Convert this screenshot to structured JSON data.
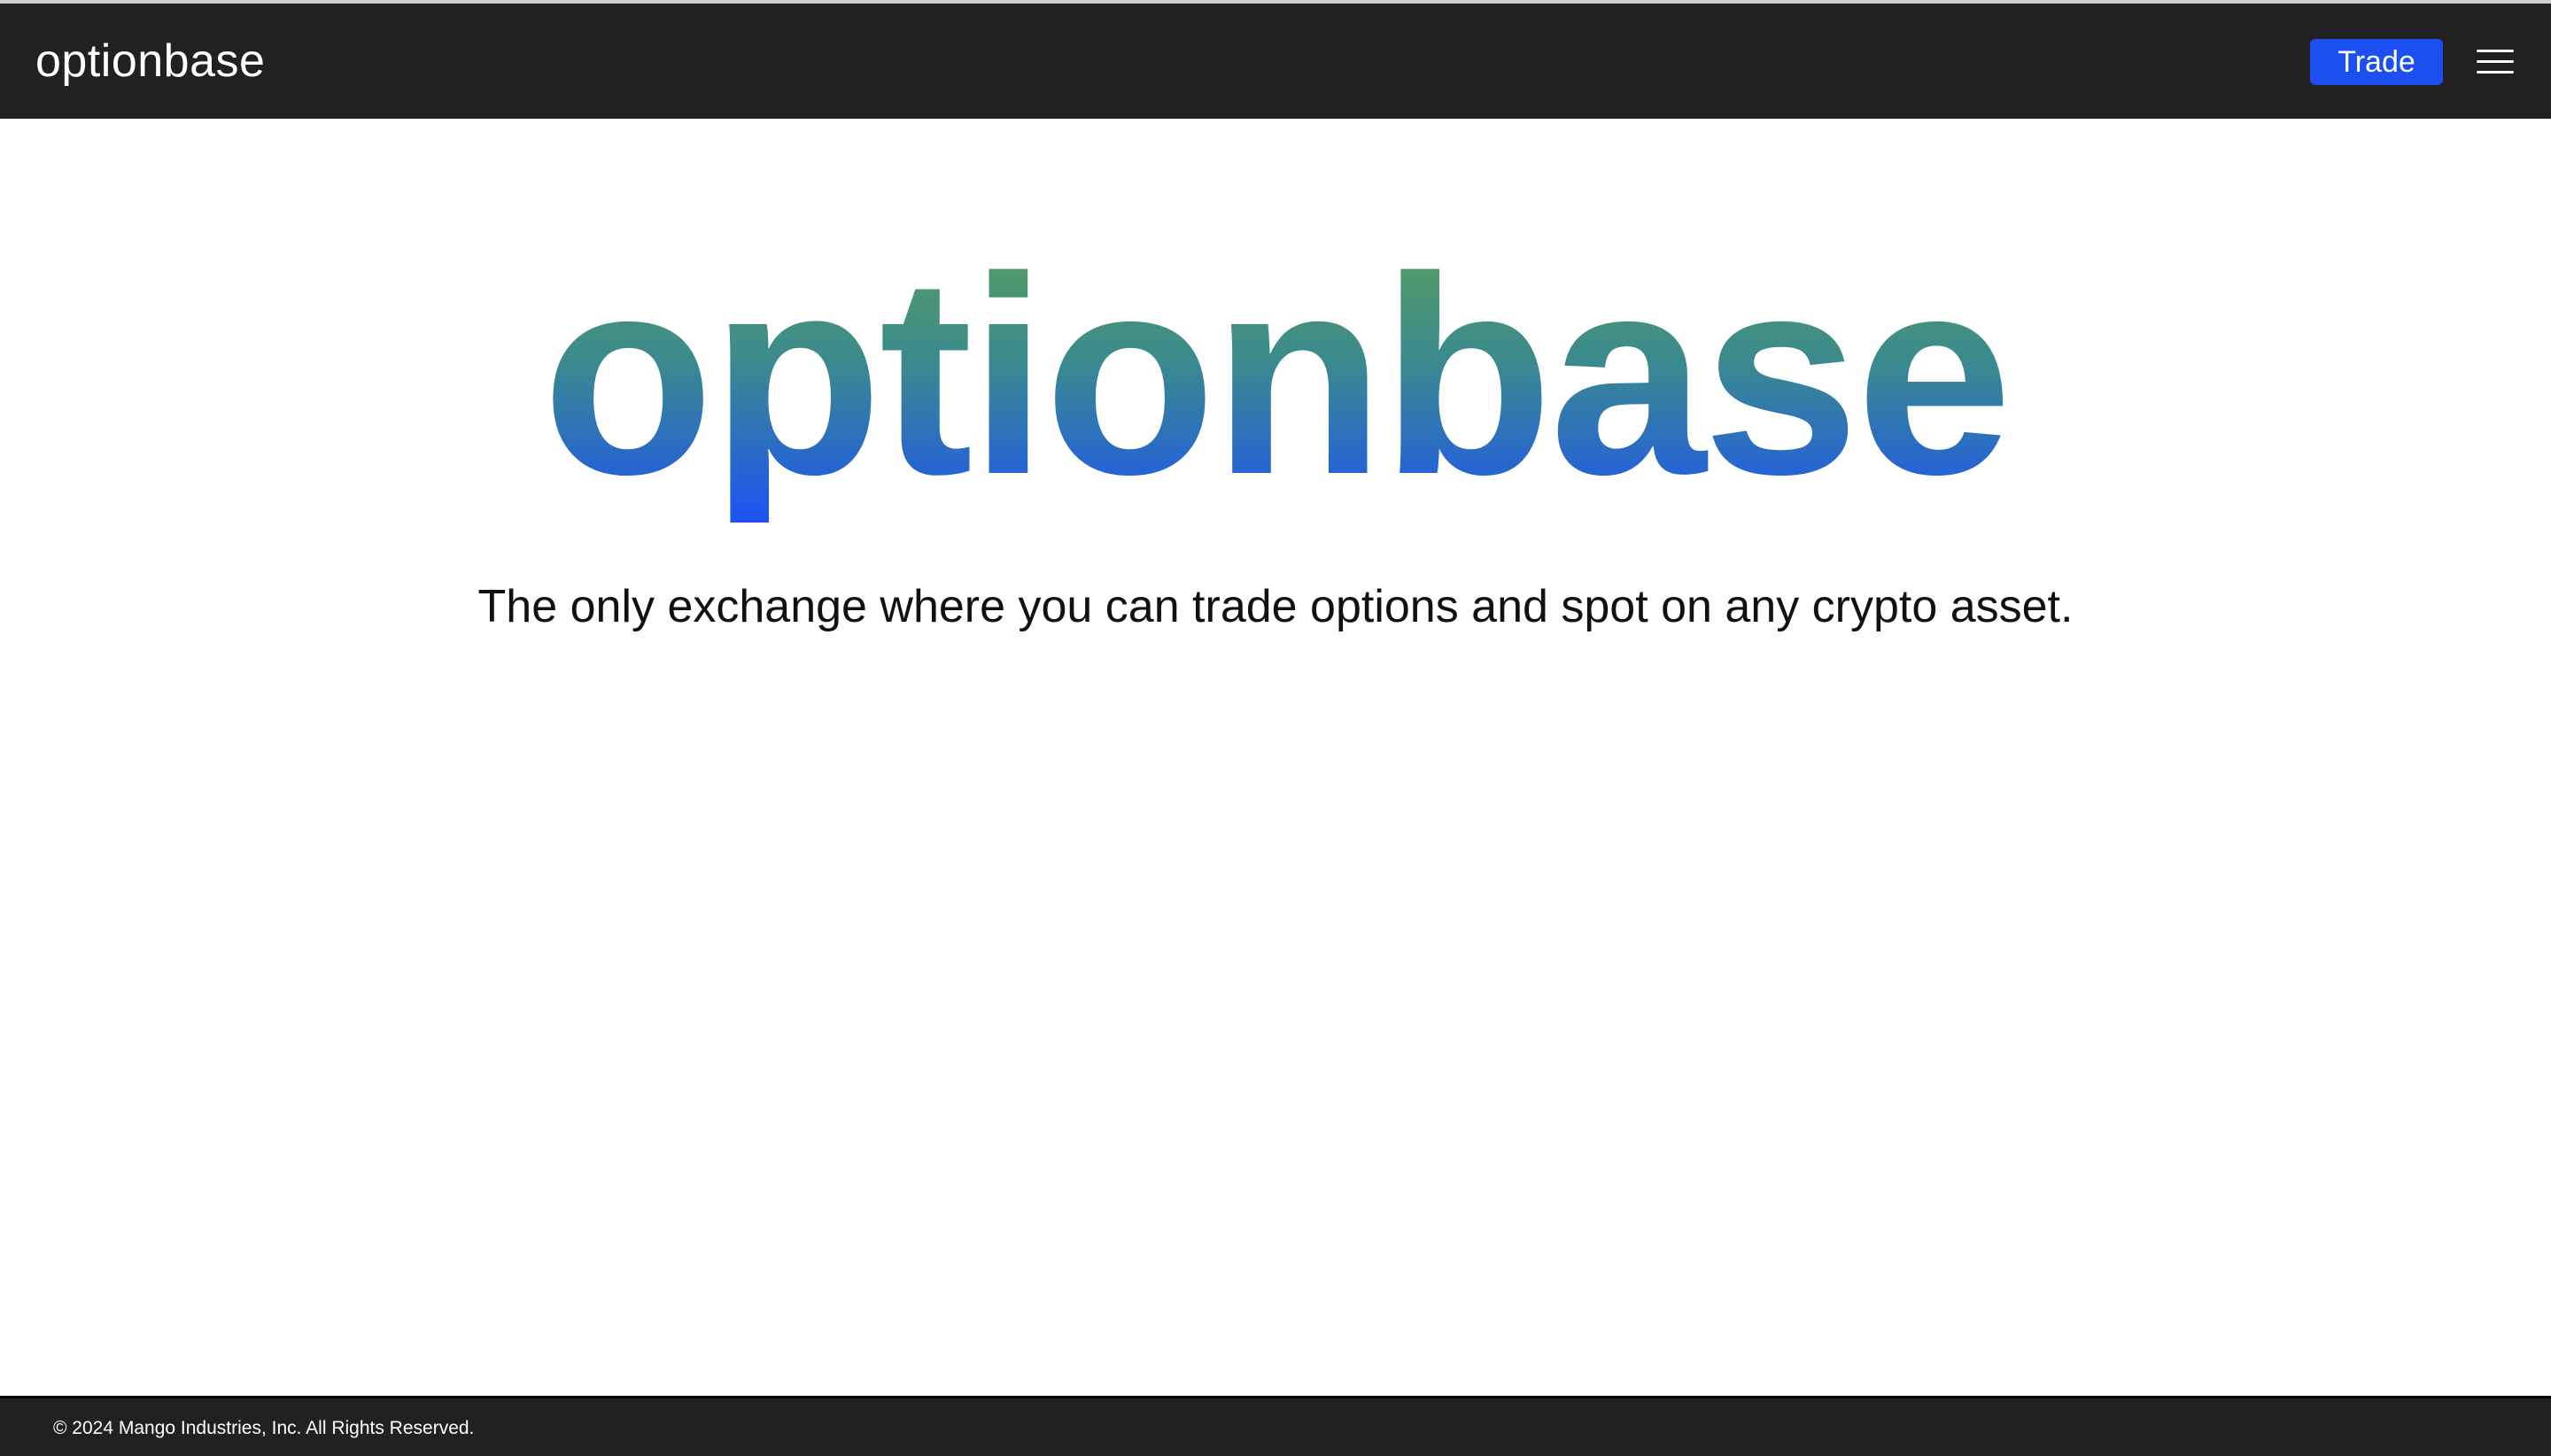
{
  "navbar": {
    "brand": "optionbase",
    "trade_label": "Trade",
    "menu_icon": "hamburger-menu-icon"
  },
  "hero": {
    "title": "optionbase",
    "tagline": "The only exchange where you can trade options and spot on any crypto asset."
  },
  "footer": {
    "copyright": "© 2024 Mango Industries, Inc. All Rights Reserved."
  },
  "colors": {
    "navbar_bg": "#212121",
    "accent": "#1b4ff2",
    "gradient_top": "#5a9e5d",
    "gradient_bottom": "#1c53f2"
  }
}
